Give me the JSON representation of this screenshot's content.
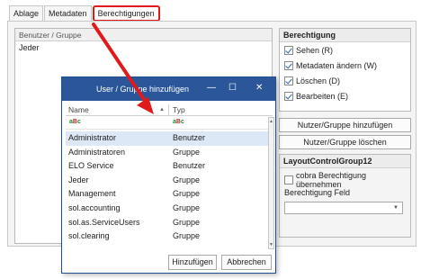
{
  "tabs": [
    {
      "label": "Ablage"
    },
    {
      "label": "Metadaten"
    },
    {
      "label": "Berechtigungen",
      "active": true
    }
  ],
  "users_panel": {
    "header": "Benutzer / Gruppe",
    "rows": [
      "Jeder"
    ]
  },
  "permissions": {
    "title": "Berechtigung",
    "items": [
      {
        "label": "Sehen (R)",
        "checked": true
      },
      {
        "label": "Metadaten ändern (W)",
        "checked": true
      },
      {
        "label": "Löschen (D)",
        "checked": true
      },
      {
        "label": "Bearbeiten (E)",
        "checked": true
      }
    ]
  },
  "buttons": {
    "add_user_group": "Nutzer/Gruppe hinzufügen",
    "delete_user_group": "Nutzer/Gruppe löschen"
  },
  "group12": {
    "title": "LayoutControlGroup12",
    "adopt_label": "cobra Berechtigung übernehmen",
    "field_label": "Berechtigung Feld",
    "field_value": ""
  },
  "dialog": {
    "title": "User / Gruppe hinzufügen",
    "columns": {
      "name": "Name",
      "type": "Typ"
    },
    "filter_icon": "abc-filter-icon",
    "rows": [
      {
        "name": "Administrator",
        "type": "Benutzer",
        "selected": true
      },
      {
        "name": "Administratoren",
        "type": "Gruppe"
      },
      {
        "name": "ELO Service",
        "type": "Benutzer"
      },
      {
        "name": "Jeder",
        "type": "Gruppe"
      },
      {
        "name": "Management",
        "type": "Gruppe"
      },
      {
        "name": "sol.accounting",
        "type": "Gruppe"
      },
      {
        "name": "sol.as.ServiceUsers",
        "type": "Gruppe"
      },
      {
        "name": "sol.clearing",
        "type": "Gruppe"
      }
    ],
    "add_button": "Hinzufügen",
    "cancel_button": "Abbrechen"
  },
  "colors": {
    "titlebar": "#2b579a",
    "highlight": "#e01a1a",
    "selected_row": "#dce8f6"
  }
}
